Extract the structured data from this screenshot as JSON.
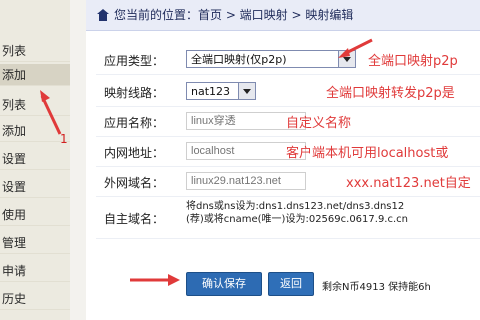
{
  "sidebar": {
    "items": [
      {
        "label": "列表",
        "active": false
      },
      {
        "label": "添加",
        "active": true
      },
      {
        "label": "列表",
        "active": false
      },
      {
        "label": "添加",
        "active": false
      },
      {
        "label": "设置",
        "active": false
      },
      {
        "label": "设置",
        "active": false
      },
      {
        "label": "使用",
        "active": false
      },
      {
        "label": "管理",
        "active": false
      },
      {
        "label": "申请",
        "active": false
      },
      {
        "label": "历史",
        "active": false
      }
    ],
    "annotation_number": "1"
  },
  "breadcrumb": {
    "text": "您当前的位置：首页 > 端口映射 > 映射编辑"
  },
  "form": {
    "rows": [
      {
        "label": "应用类型：",
        "value": "全端口映射(仅p2p)",
        "note": "全端口映射p2p"
      },
      {
        "label": "映射线路：",
        "value": "nat123",
        "note": "全端口映射转发p2p是"
      },
      {
        "label": "应用名称：",
        "placeholder": "linux穿透",
        "note": "自定义名称"
      },
      {
        "label": "内网地址：",
        "placeholder": "localhost",
        "note": "客户端本机可用localhost或"
      },
      {
        "label": "外网域名：",
        "placeholder": "linux29.nat123.net",
        "note": "xxx.nat123.net自定"
      },
      {
        "label": "自主域名：",
        "line1": "将dns或ns设为:dns1.dns123.net/dns3.dns12",
        "line2": "(荐)或将cname(唯一)设为:02569c.0617.9.c.cn"
      }
    ]
  },
  "actions": {
    "save_label": "确认保存",
    "back_label": "返回",
    "footer_text": "剩余N币4913 保持能6h"
  },
  "colors": {
    "annotation_red": "#e03a3a",
    "button_blue": "#2d6bb3",
    "breadcrumb_bg": "#e9ecf7"
  }
}
